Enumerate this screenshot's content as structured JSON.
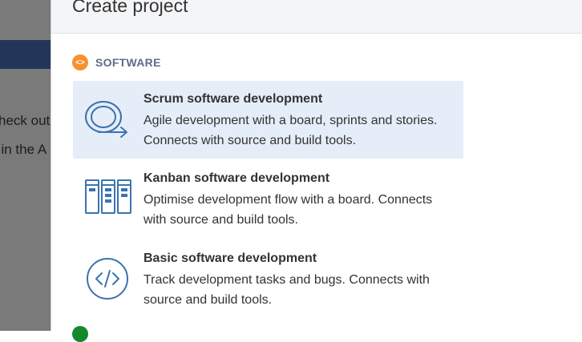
{
  "background": {
    "line1": "heck out",
    "line2": "t in the A"
  },
  "dialog": {
    "title": "Create project",
    "section": {
      "label": "SOFTWARE",
      "badge_icon": "code-brackets-icon",
      "badge_color": "#f6912e"
    },
    "options": [
      {
        "icon": "scrum-cycle-icon",
        "title": "Scrum software development",
        "description": "Agile development with a board, sprints and stories. Connects with source and build tools.",
        "selected": true
      },
      {
        "icon": "kanban-board-icon",
        "title": "Kanban software development",
        "description": "Optimise development flow with a board. Connects with source and build tools.",
        "selected": false
      },
      {
        "icon": "code-icon",
        "title": "Basic software development",
        "description": "Track development tasks and bugs. Connects with source and build tools.",
        "selected": false
      }
    ],
    "selected_bg": "#e5edf8",
    "icon_color": "#3b73af"
  }
}
